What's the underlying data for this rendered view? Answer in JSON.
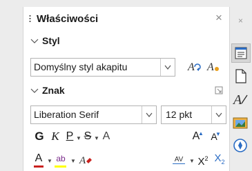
{
  "panel": {
    "title": "Właściwości",
    "close_glyph": "×"
  },
  "styl": {
    "label": "Styl",
    "paragraph_style": "Domyślny styl akapitu",
    "update_style_icon": "update-style-icon",
    "new_style_icon": "new-style-icon"
  },
  "znak": {
    "label": "Znak",
    "font_name": "Liberation Serif",
    "font_size": "12 pkt",
    "bold": "G",
    "italic": "K",
    "underline": "P",
    "strike": "S",
    "shadow": "A",
    "grow": "A",
    "shrink": "A",
    "font_color": "A",
    "highlight": "ab",
    "spacing": "AV",
    "superscript_base": "X",
    "superscript_exp": "2",
    "subscript_base": "X",
    "subscript_exp": "2"
  },
  "colors": {
    "accent_red": "#c9211e",
    "highlight_yellow": "#ffff00",
    "blue": "#2a6cc4",
    "purple": "#7a2a8a"
  },
  "sidebar": {
    "close_glyph": "×",
    "icons": [
      "properties-icon",
      "page-icon",
      "styles-icon",
      "gallery-icon",
      "navigator-icon"
    ]
  }
}
